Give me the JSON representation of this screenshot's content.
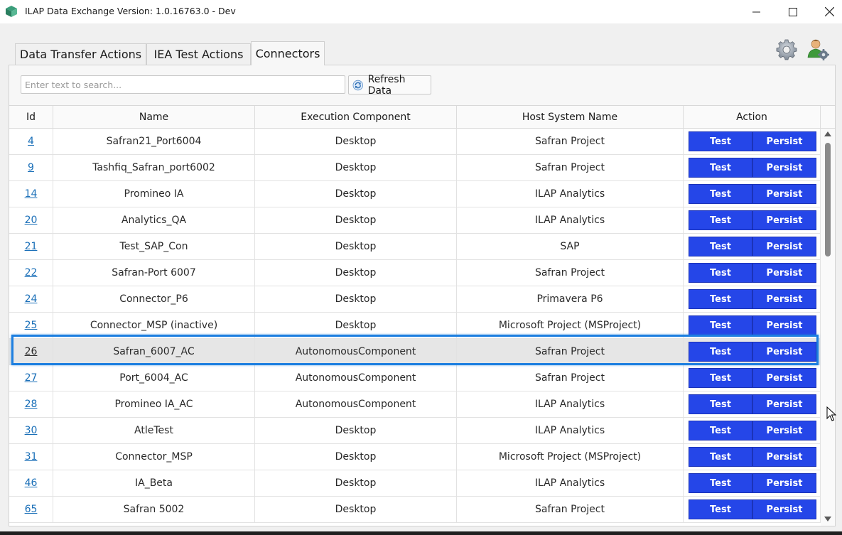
{
  "window": {
    "title": "ILAP Data Exchange Version: 1.0.16763.0 - Dev"
  },
  "tabs": [
    {
      "label": "Data Transfer Actions"
    },
    {
      "label": "IEA Test Actions"
    },
    {
      "label": "Connectors"
    }
  ],
  "active_tab": "Connectors",
  "search": {
    "placeholder": "Enter text to search...",
    "value": ""
  },
  "refresh_button": {
    "label": "Refresh Data"
  },
  "grid": {
    "columns": [
      "Id",
      "Name",
      "Execution Component",
      "Host System Name",
      "Action"
    ],
    "action_labels": {
      "test": "Test",
      "persist": "Persist"
    },
    "selected_id": "26",
    "rows": [
      {
        "id": "4",
        "name": "Safran21_Port6004",
        "exec": "Desktop",
        "host": "Safran Project"
      },
      {
        "id": "9",
        "name": "Tashfiq_Safran_port6002",
        "exec": "Desktop",
        "host": "Safran Project"
      },
      {
        "id": "14",
        "name": "Promineo IA",
        "exec": "Desktop",
        "host": "ILAP Analytics"
      },
      {
        "id": "20",
        "name": "Analytics_QA",
        "exec": "Desktop",
        "host": "ILAP Analytics"
      },
      {
        "id": "21",
        "name": "Test_SAP_Con",
        "exec": "Desktop",
        "host": "SAP"
      },
      {
        "id": "22",
        "name": "Safran-Port 6007",
        "exec": "Desktop",
        "host": "Safran Project"
      },
      {
        "id": "24",
        "name": "Connector_P6",
        "exec": "Desktop",
        "host": "Primavera P6"
      },
      {
        "id": "25",
        "name": "Connector_MSP (inactive)",
        "exec": "Desktop",
        "host": "Microsoft Project (MSProject)"
      },
      {
        "id": "26",
        "name": "Safran_6007_AC",
        "exec": "AutonomousComponent",
        "host": "Safran Project"
      },
      {
        "id": "27",
        "name": "Port_6004_AC",
        "exec": "AutonomousComponent",
        "host": "Safran Project"
      },
      {
        "id": "28",
        "name": "Promineo IA_AC",
        "exec": "AutonomousComponent",
        "host": "ILAP Analytics"
      },
      {
        "id": "30",
        "name": "AtleTest",
        "exec": "Desktop",
        "host": "ILAP Analytics"
      },
      {
        "id": "31",
        "name": "Connector_MSP",
        "exec": "Desktop",
        "host": "Microsoft Project (MSProject)"
      },
      {
        "id": "46",
        "name": "IA_Beta",
        "exec": "Desktop",
        "host": "ILAP Analytics"
      },
      {
        "id": "65",
        "name": "Safran 5002",
        "exec": "Desktop",
        "host": "Safran Project"
      }
    ]
  },
  "icons": {
    "app": "app-logo-icon",
    "settings": "gear-icon",
    "user_settings": "user-settings-icon",
    "refresh": "refresh-icon"
  },
  "colors": {
    "action_button": "#2546e8",
    "link": "#1a6fb8",
    "selection_outline": "#1e7fe0",
    "selected_row": "#e6e6e6"
  }
}
